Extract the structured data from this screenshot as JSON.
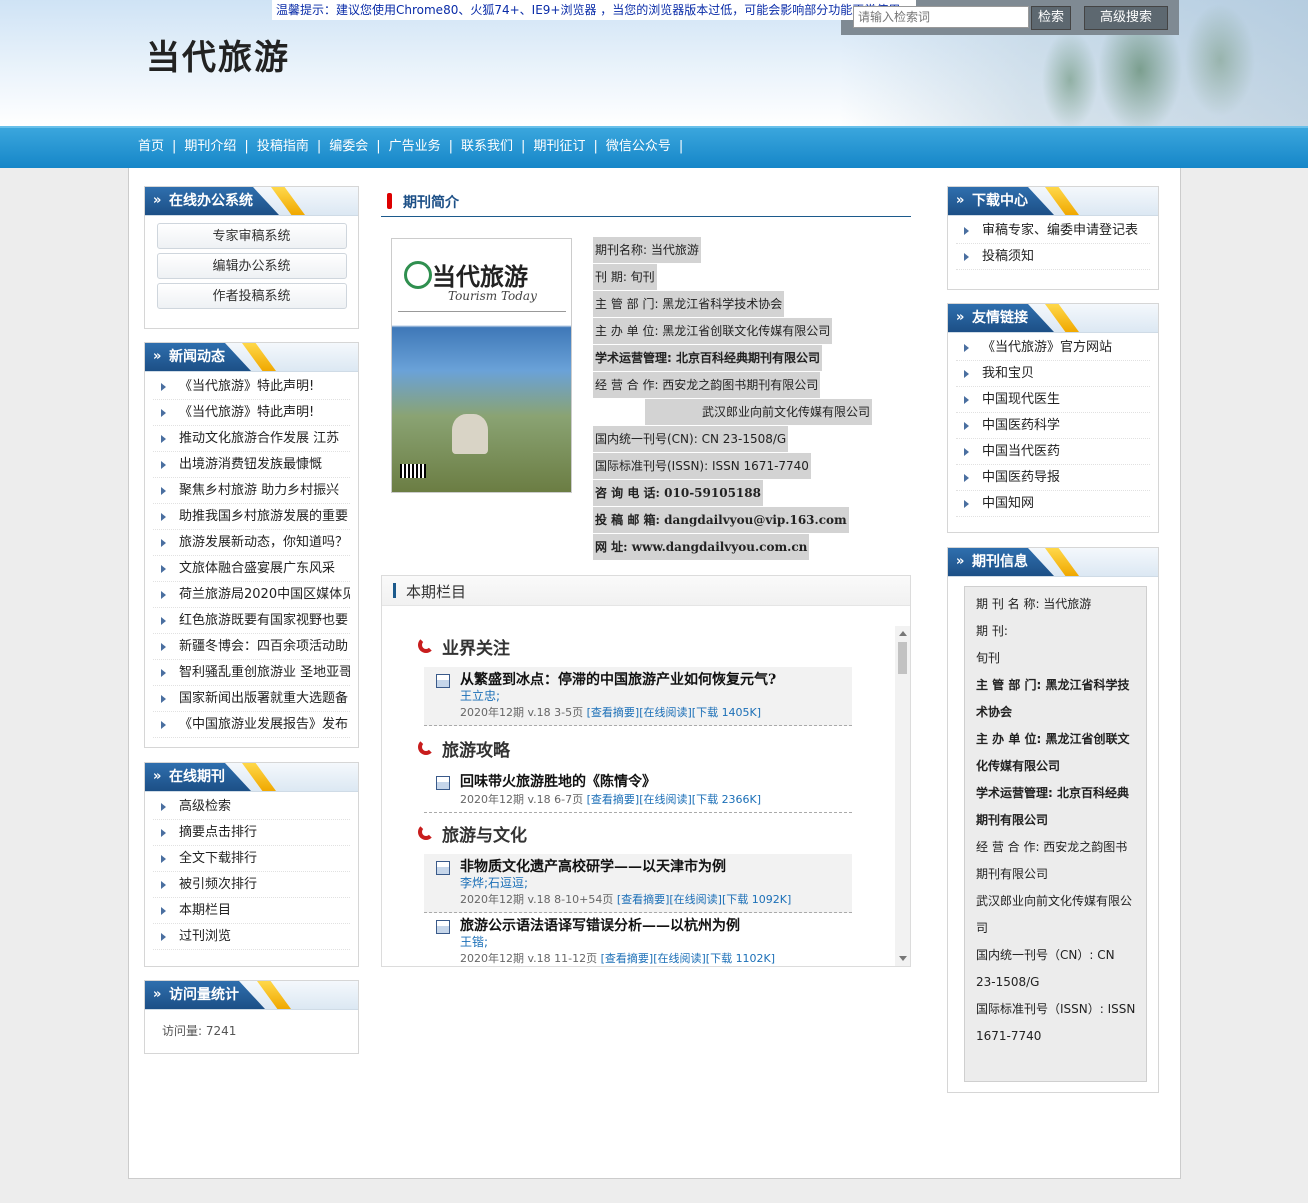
{
  "header": {
    "site_title": "当代旅游",
    "notice": "温馨提示：建议您使用Chrome80、火狐74+、IE9+浏览器 ，当您的浏览器版本过低，可能会影响部分功能正常使用。",
    "search_placeholder": "请输入检索词",
    "search_button": "检索",
    "advanced_button": "高级搜索"
  },
  "nav": {
    "items": [
      "首页",
      "期刊介绍",
      "投稿指南",
      "编委会",
      "广告业务",
      "联系我们",
      "期刊征订",
      "微信公众号"
    ],
    "separator": "|"
  },
  "left": {
    "office": {
      "title": "在线办公系统",
      "buttons": [
        "专家审稿系统",
        "编辑办公系统",
        "作者投稿系统"
      ]
    },
    "news": {
      "title": "新闻动态",
      "items": [
        "《当代旅游》特此声明!",
        "《当代旅游》特此声明!",
        "推动文化旅游合作发展 江苏",
        "出境游消费钮发族最慷慨",
        "聚焦乡村旅游 助力乡村振兴",
        "助推我国乡村旅游发展的重要",
        "旅游发展新动态，你知道吗？",
        "文旅体融合盛宴展广东风采",
        "荷兰旅游局2020中国区媒体见",
        "红色旅游既要有国家视野也要",
        "新疆冬博会：四百余项活动助",
        "智利骚乱重创旅游业 圣地亚哥",
        "国家新闻出版署就重大选题备",
        "《中国旅游业发展报告》发布"
      ]
    },
    "online": {
      "title": "在线期刊",
      "items": [
        "高级检索",
        "摘要点击排行",
        "全文下载排行",
        "被引频次排行",
        "本期栏目",
        "过刊浏览"
      ]
    },
    "stats": {
      "title": "访问量统计",
      "visits": "访问量: 7241"
    }
  },
  "center": {
    "intro_title": "期刊简介",
    "cover": {
      "title": "当代旅游",
      "subtitle": "Tourism Today"
    },
    "info": [
      "期刊名称: 当代旅游",
      "刊      期: 旬刊",
      "主 管 部 门: 黑龙江省科学技术协会",
      "主 办 单 位: 黑龙江省创联文化传媒有限公司",
      "学术运营管理: 北京百科经典期刊有限公司",
      "经 营 合 作: 西安龙之韵图书期刊有限公司",
      "武汉郎业向前文化传媒有限公司",
      "国内统一刊号(CN): CN 23-1508/G",
      "国际标准刊号(ISSN): ISSN 1671-7740",
      "咨 询 电 话: 010-59105188",
      "投 稿 邮 箱: dangdailvyou@vip.163.com",
      "网 址: www.dangdailvyou.com.cn"
    ],
    "issue": {
      "title": "本期栏目",
      "sections": [
        {
          "name": "业界关注",
          "articles": [
            {
              "title": "从繁盛到冰点：停滞的中国旅游产业如何恢复元气?",
              "author": "王立忠;",
              "meta": "2020年12期 v.18 3-5页",
              "links": "[查看摘要][在线阅读][下载 1405K]"
            }
          ]
        },
        {
          "name": "旅游攻略",
          "articles": [
            {
              "title": "回味带火旅游胜地的《陈情令》",
              "author": "",
              "meta": "2020年12期 v.18 6-7页",
              "links": "[查看摘要][在线阅读][下载 2366K]"
            }
          ]
        },
        {
          "name": "旅游与文化",
          "articles": [
            {
              "title": "非物质文化遗产高校研学——以天津市为例",
              "author": "李烨;石逗逗;",
              "meta": "2020年12期 v.18 8-10+54页",
              "links": "[查看摘要][在线阅读][下载 1092K]"
            },
            {
              "title": "旅游公示语法语译写错误分析——以杭州为例",
              "author": "王锴;",
              "meta": "2020年12期 v.18 11-12页",
              "links": "[查看摘要][在线阅读][下载 1102K]"
            }
          ]
        }
      ]
    }
  },
  "right": {
    "download": {
      "title": "下载中心",
      "items": [
        "审稿专家、编委申请登记表",
        "投稿须知"
      ]
    },
    "links": {
      "title": "友情链接",
      "items": [
        "《当代旅游》官方网站",
        "我和宝贝",
        "中国现代医生",
        "中国医药科学",
        "中国当代医药",
        "中国医药导报",
        "中国知网"
      ]
    },
    "journal": {
      "title": "期刊信息",
      "lines": [
        "期 刊 名 称: 当代旅游",
        "期            刊:",
        "旬刊",
        "主 管 部 门: 黑龙江省科学技术协会",
        "主 办 单 位: 黑龙江省创联文化传媒有限公司",
        "学术运营管理: 北京百科经典期刊有限公司",
        "经 营 合 作: 西安龙之韵图书期刊有限公司",
        "武汉郎业向前文化传媒有限公司",
        "国内统一刊号（CN）: CN 23-1508/G",
        "国际标准刊号（ISSN）: ISSN 1671-7740"
      ]
    }
  }
}
